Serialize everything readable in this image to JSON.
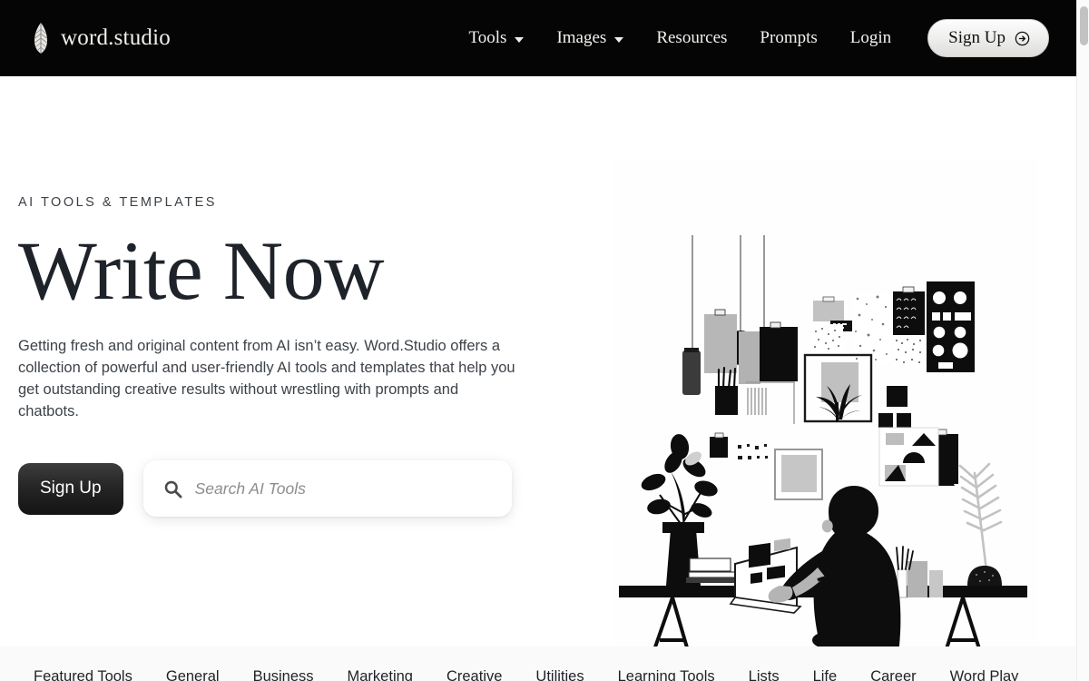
{
  "header": {
    "brand_name": "word.studio",
    "brand_icon": "feather-quill-icon",
    "nav": [
      {
        "label": "Tools",
        "has_dropdown": true
      },
      {
        "label": "Images",
        "has_dropdown": true
      },
      {
        "label": "Resources",
        "has_dropdown": false
      },
      {
        "label": "Prompts",
        "has_dropdown": false
      },
      {
        "label": "Login",
        "has_dropdown": false
      }
    ],
    "signup_label": "Sign Up",
    "signup_icon": "arrow-right-circle-icon",
    "background_color": "#050505"
  },
  "hero": {
    "eyebrow": "AI TOOLS & TEMPLATES",
    "headline": "Write Now",
    "subcopy": "Getting fresh and original content from AI isn’t easy. Word.Studio offers a collection of powerful and user-friendly AI tools and templates that help you get outstanding creative results without wrestling with prompts and chatbots.",
    "signup_label": "Sign Up",
    "search": {
      "placeholder": "Search AI Tools",
      "value": "",
      "icon": "search-icon"
    },
    "illustration_alt": "person-at-desk-with-laptop-illustration"
  },
  "categories": {
    "tabs": [
      "Featured Tools",
      "General",
      "Business",
      "Marketing",
      "Creative",
      "Utilities",
      "Learning Tools",
      "Lists",
      "Life",
      "Career",
      "Word Play"
    ]
  },
  "colors": {
    "header_bg": "#050505",
    "page_bg": "#ffffff",
    "headline": "#1e2229",
    "body_text": "#3d434a",
    "cta_dark": "#141414",
    "tab_bar_bg": "#fafafa",
    "scrollbar_thumb": "#c2c2c2"
  }
}
